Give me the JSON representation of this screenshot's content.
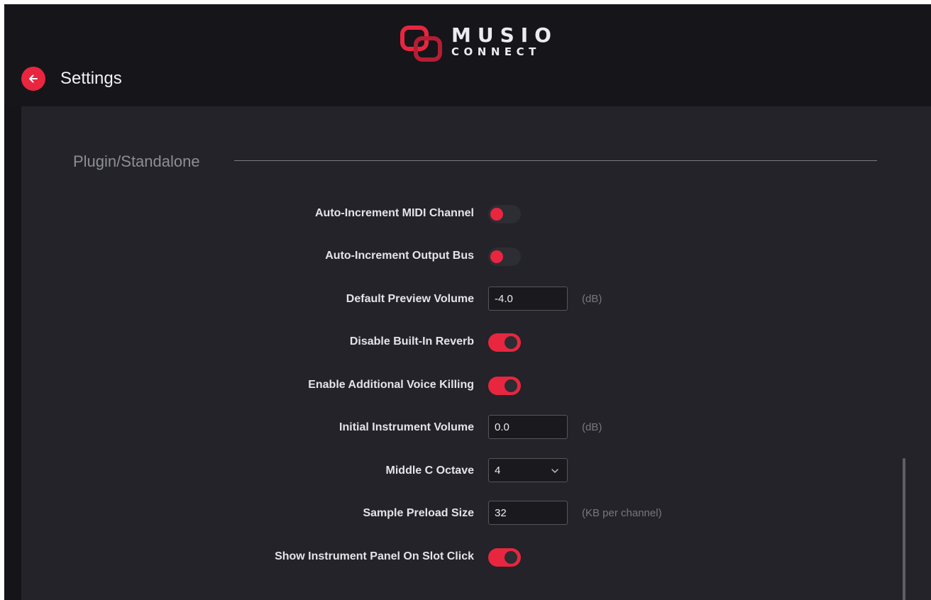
{
  "app": {
    "logo_line1": "MUSIO",
    "logo_line2": "CONNECT",
    "brand_color": "#e8263f"
  },
  "header": {
    "back_icon": "arrow-left-icon",
    "title": "Settings"
  },
  "section": {
    "title": "Plugin/Standalone"
  },
  "settings": [
    {
      "label": "Auto-Increment MIDI Channel",
      "type": "toggle",
      "state": "off"
    },
    {
      "label": "Auto-Increment Output Bus",
      "type": "toggle",
      "state": "off"
    },
    {
      "label": "Default Preview Volume",
      "type": "number",
      "value": "-4.0",
      "unit": "(dB)"
    },
    {
      "label": "Disable Built-In Reverb",
      "type": "toggle",
      "state": "on"
    },
    {
      "label": "Enable Additional Voice Killing",
      "type": "toggle",
      "state": "on"
    },
    {
      "label": "Initial Instrument Volume",
      "type": "number",
      "value": "0.0",
      "unit": "(dB)"
    },
    {
      "label": "Middle C Octave",
      "type": "select",
      "value": "4",
      "icon": "chevron-down-icon"
    },
    {
      "label": "Sample Preload Size",
      "type": "number",
      "value": "32",
      "unit": "(KB per channel)"
    },
    {
      "label": "Show Instrument Panel On Slot Click",
      "type": "toggle",
      "state": "on"
    }
  ]
}
